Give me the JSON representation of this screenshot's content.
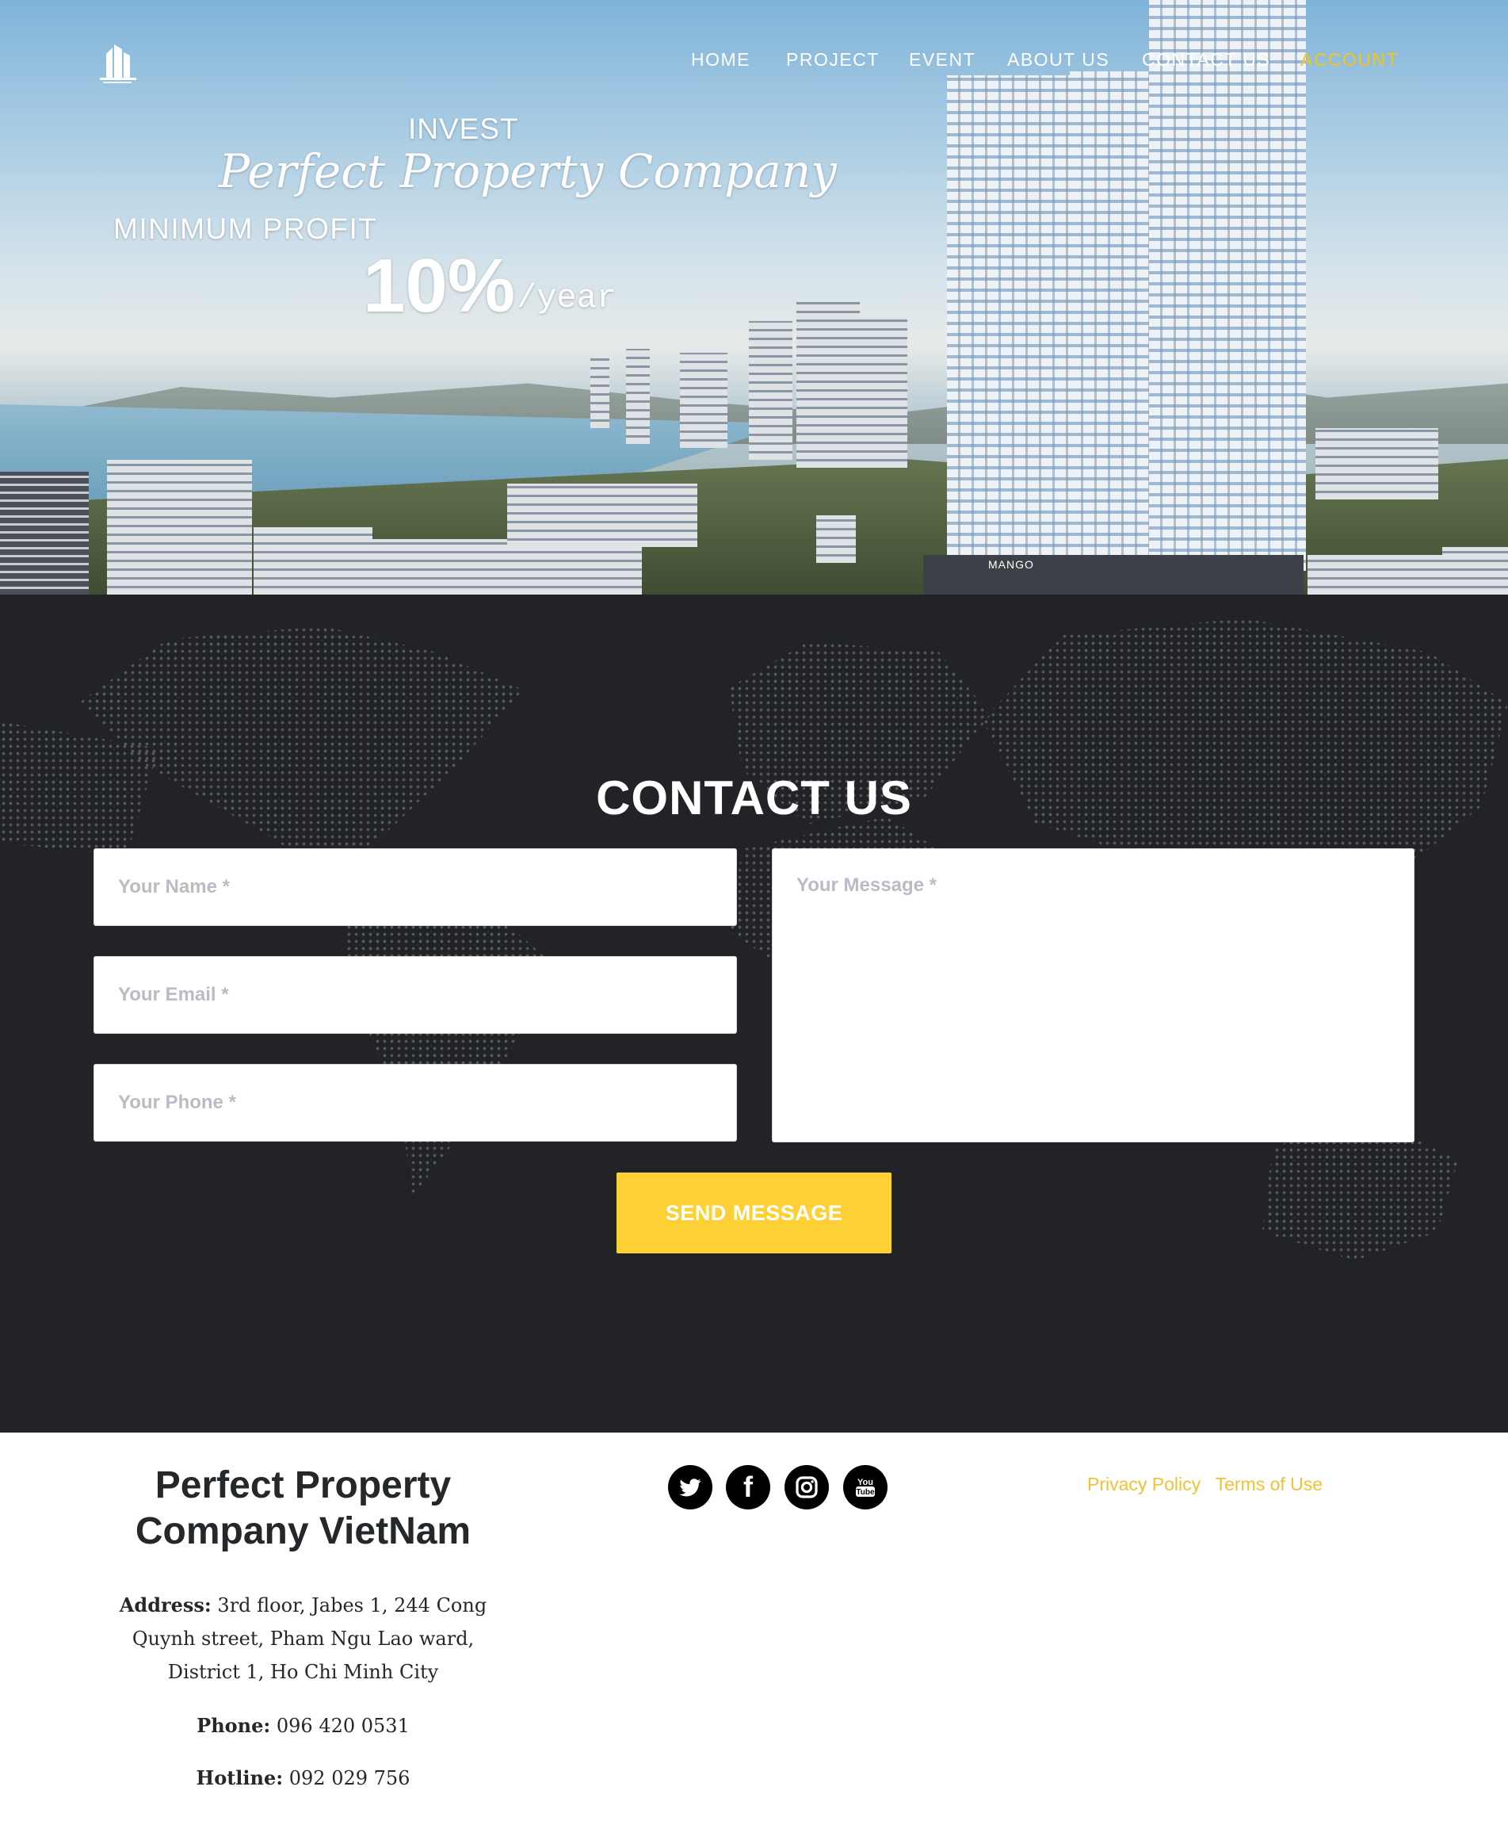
{
  "nav": {
    "items": [
      {
        "label": "HOME",
        "color": "#ffffff"
      },
      {
        "label": "PROJECT",
        "color": "#ffffff"
      },
      {
        "label": "EVENT",
        "color": "#ffffff"
      },
      {
        "label": "ABOUT US",
        "color": "#ffffff"
      },
      {
        "label": "CONTACT US",
        "color": "#ffffff"
      },
      {
        "label": "ACCOUNT",
        "color": "#f5c518"
      }
    ]
  },
  "hero": {
    "line1": "INVEST",
    "line2": "Perfect Property Company",
    "line3": "MINIMUM PROFIT",
    "percent": "10%",
    "unit": "/year",
    "sign": "MANGO"
  },
  "contact": {
    "title": "CONTACT US",
    "name_placeholder": "Your Name *",
    "email_placeholder": "Your Email *",
    "phone_placeholder": "Your Phone *",
    "message_placeholder": "Your Message *",
    "send_label": "SEND MESSAGE",
    "button_color": "#fdd035"
  },
  "footer": {
    "company": "Perfect Property Company VietNam",
    "address_label": "Address:",
    "address": "3rd floor, Jabes 1, 244 Cong Quynh street, Pham Ngu Lao ward, District 1, Ho Chi Minh City",
    "phone_label": "Phone:",
    "phone": "096 420 0531",
    "hotline_label": "Hotline:",
    "hotline": "092 029 756",
    "socials": [
      {
        "name": "twitter-icon"
      },
      {
        "name": "facebook-icon"
      },
      {
        "name": "instagram-icon"
      },
      {
        "name": "youtube-icon"
      }
    ],
    "links": [
      "Privacy Policy",
      "Terms of Use"
    ],
    "link_color": "#f0c235"
  }
}
